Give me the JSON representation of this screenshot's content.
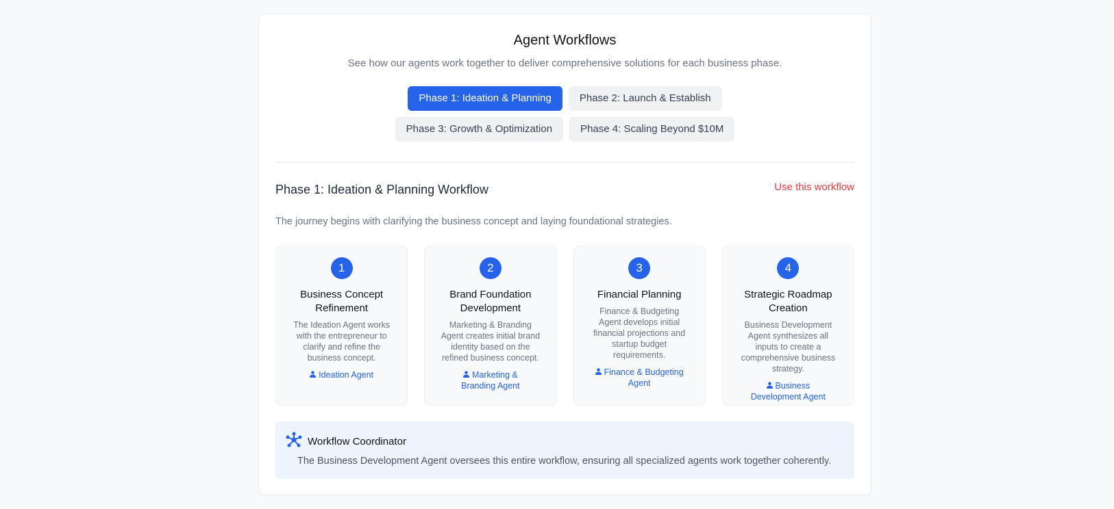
{
  "header": {
    "title": "Agent Workflows",
    "subtitle": "See how our agents work together to deliver comprehensive solutions for each business phase."
  },
  "tabs": [
    {
      "label": "Phase 1: Ideation & Planning",
      "active": true
    },
    {
      "label": "Phase 2: Launch & Establish",
      "active": false
    },
    {
      "label": "Phase 3: Growth & Optimization",
      "active": false
    },
    {
      "label": "Phase 4: Scaling Beyond $10M",
      "active": false
    }
  ],
  "phase": {
    "title": "Phase 1: Ideation & Planning Workflow",
    "action_label": "Use this workflow",
    "description": "The journey begins with clarifying the business concept and laying foundational strategies."
  },
  "steps": [
    {
      "number": "1",
      "title": "Business Concept Refinement",
      "text": "The Ideation Agent works with the entrepreneur to clarify and refine the business concept.",
      "agent": "Ideation Agent",
      "icon": "person-icon"
    },
    {
      "number": "2",
      "title": "Brand Foundation Development",
      "text": "Marketing & Branding Agent creates initial brand identity based on the refined business concept.",
      "agent": "Marketing & Branding Agent",
      "icon": "person-icon"
    },
    {
      "number": "3",
      "title": "Financial Planning",
      "text": "Finance & Budgeting Agent develops initial financial projections and startup budget requirements.",
      "agent": "Finance & Budgeting Agent",
      "icon": "person-icon"
    },
    {
      "number": "4",
      "title": "Strategic Roadmap Creation",
      "text": "Business Development Agent synthesizes all inputs to create a comprehensive business strategy.",
      "agent": "Business Development Agent",
      "icon": "person-icon"
    }
  ],
  "coordinator": {
    "icon": "network-icon",
    "title": "Workflow Coordinator",
    "text": "The Business Development Agent oversees this entire workflow, ensuring all specialized agents work together coherently."
  },
  "colors": {
    "accent": "#2563eb",
    "action": "#ef3b3b",
    "coordinator_bg": "#eef4fd"
  }
}
